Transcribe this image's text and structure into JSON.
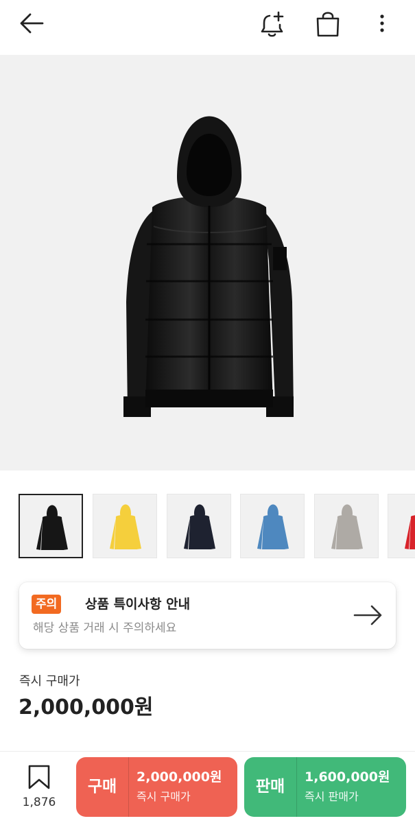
{
  "header": {
    "back_icon": "arrow-left-icon",
    "alert_icon": "bell-plus-icon",
    "cart_icon": "shopping-bag-icon",
    "more_icon": "more-vertical-icon"
  },
  "product": {
    "main_image": "black-puffer-jacket-image",
    "thumbnails": [
      {
        "color": "#161616",
        "selected": true
      },
      {
        "color": "#f5cf3c",
        "selected": false
      },
      {
        "color": "#1e2230",
        "selected": false
      },
      {
        "color": "#4e88bf",
        "selected": false
      },
      {
        "color": "#aeaaa5",
        "selected": false
      },
      {
        "color": "#d8232a",
        "selected": false
      }
    ]
  },
  "notice": {
    "badge": "주의",
    "title": "상품 특이사항 안내",
    "subtitle": "해당 상품 거래 시 주의하세요",
    "arrow_icon": "arrow-right-icon"
  },
  "price": {
    "label": "즉시 구매가",
    "value": "2,000,000원"
  },
  "bottom_bar": {
    "wishlist_icon": "bookmark-icon",
    "wishlist_count": "1,876",
    "buy": {
      "label": "구매",
      "amount": "2,000,000원",
      "caption": "즉시 구매가",
      "color": "#ef6253"
    },
    "sell": {
      "label": "판매",
      "amount": "1,600,000원",
      "caption": "즉시 판매가",
      "color": "#41b979"
    }
  }
}
